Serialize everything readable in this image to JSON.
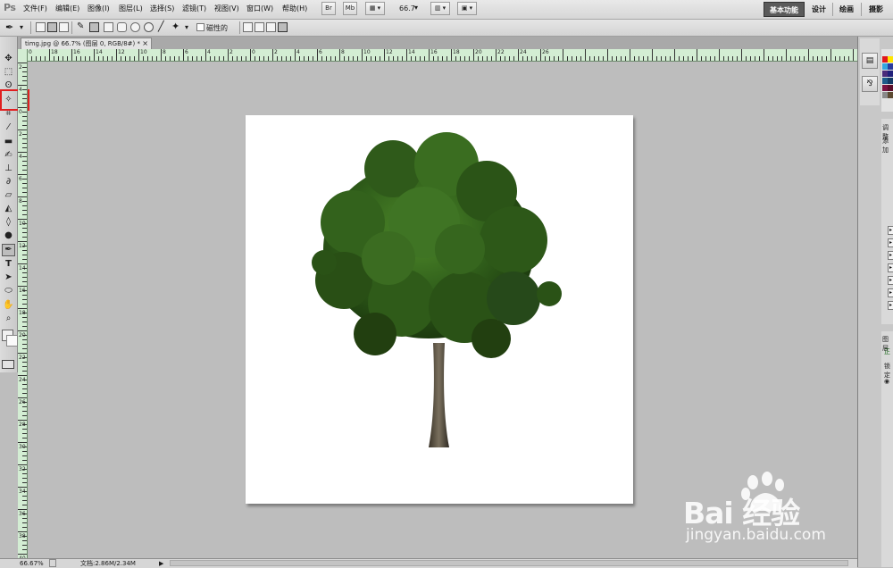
{
  "app": {
    "logo": "Ps"
  },
  "menu": [
    "文件(F)",
    "编辑(E)",
    "图像(I)",
    "图层(L)",
    "选择(S)",
    "滤镜(T)",
    "视图(V)",
    "窗口(W)",
    "帮助(H)"
  ],
  "menubar": {
    "br_label": "Br",
    "mb_label": "Mb",
    "zoom_value": "66.7"
  },
  "workspaces": [
    "基本功能",
    "设计",
    "绘画",
    "摄影"
  ],
  "options": {
    "magnetic_label": "磁性的"
  },
  "document": {
    "tab_title": "timg.jpg @ 66.7% (图层 0, RGB/8#) *",
    "close": "×"
  },
  "rulers": {
    "h_labels": [
      "0",
      "18",
      "16",
      "14",
      "12",
      "10",
      "8",
      "6",
      "4",
      "2",
      "0",
      "2",
      "4",
      "6",
      "8",
      "10",
      "12",
      "14",
      "16",
      "18",
      "20",
      "22",
      "24",
      "26"
    ],
    "v_labels": [
      "2",
      "4",
      "0",
      "2",
      "4",
      "6",
      "8",
      "10",
      "12",
      "14",
      "16",
      "18",
      "20",
      "22",
      "24",
      "26",
      "28",
      "30",
      "32",
      "34",
      "36",
      "38",
      "40"
    ]
  },
  "status": {
    "zoom": "66.67%",
    "doc_info": "文档:2.86M/2.34M"
  },
  "right_panel": {
    "adjust_label": "调整",
    "add_label": "添加",
    "layers_label": "图层",
    "normal_label": "正",
    "lock_label": "锁定"
  },
  "watermark": {
    "brand": "Bai  经验",
    "url": "jingyan.baidu.com"
  },
  "colors": {
    "highlight": "#e02020",
    "ruler_bg": "#d3edd3",
    "workspace_bg": "#bdbdbd",
    "tree_green": "#2f5a1a"
  }
}
